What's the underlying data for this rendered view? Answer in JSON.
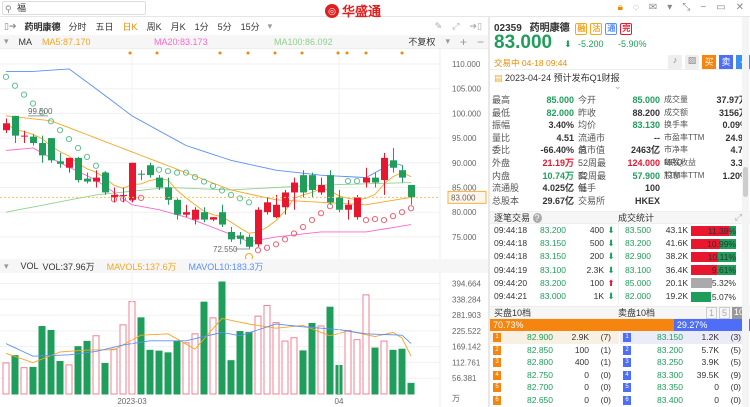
{
  "topbar": {
    "search_value": "福",
    "logo": "华盛通"
  },
  "toolbar": {
    "stock_name": "药明康德",
    "periods": [
      "分时",
      "五日",
      "日K",
      "周K",
      "月K",
      "1分",
      "5分",
      "15分"
    ],
    "active": "日K"
  },
  "ma_legend": {
    "label": "MA",
    "ma5": "MA5:87.170",
    "ma20": "MA20:83.173",
    "ma100": "MA100:86.092",
    "adjust": "不复权"
  },
  "vol_legend": {
    "label": "VOL",
    "vol": "VOL:37.96万",
    "mavol5": "MAVOL5:137.6万",
    "mavol10": "MAVOL10:183.3万"
  },
  "colors": {
    "up": "#e8162e",
    "down": "#1e9e5a",
    "ma5": "#f5a623",
    "ma20": "#ff66cc",
    "ma100": "#8fd18f",
    "blue": "#5b8ff9",
    "accent": "#f08a00"
  },
  "chart_data": [
    {
      "type": "candlestick",
      "title": "药明康德 日K",
      "yaxis": {
        "ticks": [
          110,
          105,
          100,
          95,
          90,
          85,
          80,
          75
        ],
        "tick_labels": [
          "110.000",
          "105.000",
          "100.000",
          "95.000",
          "90.000",
          "85.000",
          "80.000",
          "75.000"
        ],
        "range": [
          71,
          112
        ]
      },
      "current_price": "83.000",
      "high_label": "99.500",
      "low_label": "72.550",
      "xticks": [
        {
          "index": 14,
          "label": "2023-03"
        },
        {
          "index": 37,
          "label": "04"
        }
      ],
      "ohlc": [
        [
          96.6,
          99,
          96,
          98
        ],
        [
          99.5,
          99.5,
          94,
          95.5
        ],
        [
          95.3,
          96.5,
          94,
          95.5
        ],
        [
          95.3,
          95.8,
          93.5,
          94
        ],
        [
          94,
          95.5,
          90,
          91.5
        ],
        [
          95,
          95,
          90,
          90.5
        ],
        [
          90.3,
          92,
          89,
          89.8
        ],
        [
          89,
          91,
          88,
          91
        ],
        [
          91,
          91.2,
          86,
          86.5
        ],
        [
          86.8,
          88,
          85.8,
          86.2
        ],
        [
          86.2,
          88.5,
          85,
          87
        ],
        [
          88,
          88.3,
          83.5,
          84
        ],
        [
          83,
          85,
          82,
          83.5
        ],
        [
          83.3,
          85,
          82,
          83.5
        ],
        [
          82.5,
          90,
          82,
          90
        ],
        [
          87.8,
          88.5,
          86.5,
          87.6
        ],
        [
          89.5,
          90,
          87,
          87.5
        ],
        [
          87,
          87.5,
          84.5,
          85
        ],
        [
          85,
          87,
          81.5,
          82.5
        ],
        [
          82.5,
          82.8,
          78.5,
          79.5
        ],
        [
          79.5,
          81.5,
          79,
          80
        ],
        [
          78.5,
          81,
          77.5,
          80.5
        ],
        [
          80,
          81,
          78,
          78.5
        ],
        [
          78.5,
          79,
          78.2,
          79
        ],
        [
          80,
          81.5,
          77,
          77.5
        ],
        [
          76,
          77,
          74,
          74.5
        ],
        [
          75.3,
          76,
          73.5,
          74.6
        ],
        [
          75,
          75.5,
          72.55,
          73
        ],
        [
          73.5,
          81,
          73,
          80.5
        ],
        [
          80,
          83,
          79.5,
          82
        ],
        [
          79,
          83.5,
          78.8,
          81.5
        ],
        [
          81,
          84.5,
          79.5,
          84
        ],
        [
          84,
          87,
          80.5,
          86
        ],
        [
          87.5,
          88.5,
          83,
          84
        ],
        [
          87.5,
          88,
          83,
          84.5
        ],
        [
          84,
          87,
          83.5,
          85.5
        ],
        [
          87.5,
          88.5,
          81.5,
          82
        ],
        [
          83,
          84.5,
          80,
          80.5
        ],
        [
          80.5,
          82.5,
          78.5,
          81.5
        ],
        [
          79,
          83.5,
          78.5,
          83
        ],
        [
          86,
          89,
          85,
          87
        ],
        [
          87,
          88,
          85,
          86
        ],
        [
          86.5,
          92,
          83.5,
          91
        ],
        [
          90.5,
          93,
          88,
          89
        ],
        [
          88.5,
          89.5,
          86,
          87
        ],
        [
          85.5,
          85.5,
          81.5,
          83
        ]
      ],
      "lines": {
        "blue": [
          [
            0,
            108.5
          ],
          [
            3,
            108.5
          ],
          [
            7,
            109
          ],
          [
            10,
            105
          ],
          [
            14,
            99.5
          ],
          [
            17,
            96.5
          ],
          [
            20,
            93.5
          ],
          [
            25,
            90.5
          ],
          [
            30,
            88.5
          ],
          [
            35,
            87.5
          ],
          [
            40,
            87
          ],
          [
            43,
            90
          ],
          [
            44,
            89.5
          ]
        ],
        "ma20": [
          [
            0,
            92.5
          ],
          [
            3,
            93
          ],
          [
            6,
            90
          ],
          [
            10,
            86.5
          ],
          [
            14,
            81.5
          ],
          [
            17,
            80.5
          ],
          [
            20,
            79
          ],
          [
            25,
            75.5
          ],
          [
            27,
            74
          ],
          [
            30,
            75
          ],
          [
            35,
            76
          ],
          [
            40,
            76
          ],
          [
            45,
            77.5
          ]
        ],
        "ma100": [
          [
            0,
            80
          ],
          [
            10,
            83.5
          ],
          [
            18,
            85
          ],
          [
            25,
            84.5
          ],
          [
            35,
            85.5
          ],
          [
            45,
            86
          ]
        ],
        "orange_long": [
          [
            0,
            99.5
          ],
          [
            5,
            98.5
          ],
          [
            10,
            95
          ],
          [
            15,
            91.5
          ],
          [
            20,
            88
          ],
          [
            25,
            84.5
          ],
          [
            30,
            82.5
          ],
          [
            35,
            82
          ],
          [
            40,
            81.5
          ],
          [
            45,
            83
          ]
        ]
      },
      "sar": [
        107.4,
        105.6,
        103.8,
        102,
        100.2,
        98.4,
        96.6,
        94.8,
        93,
        91.2,
        89.4,
        87.6,
        82.6,
        82.7,
        82.8,
        82.9,
        88.9,
        88.6,
        88.3,
        88,
        88,
        87.1,
        86.2,
        85.3,
        84.4,
        83.5,
        82.8,
        82,
        72.3,
        72.8,
        73.5,
        74.5,
        75.7,
        77,
        78.4,
        79.8,
        81.2,
        82.5,
        86.3,
        86.3,
        78.4,
        78.6,
        78.4,
        79.2,
        80,
        80.8
      ]
    },
    {
      "type": "bar",
      "title": "VOL",
      "unit": "万",
      "yaxis": {
        "tick_labels": [
          "394.664",
          "338.284",
          "281.903",
          "225.522",
          "169.142",
          "112.761",
          "56.381"
        ],
        "range": [
          0,
          410
        ]
      },
      "values": [
        111,
        137,
        94,
        95,
        241,
        227,
        116,
        104,
        169,
        188,
        208,
        109,
        160,
        247,
        330,
        272,
        156,
        153,
        147,
        189,
        183,
        215,
        328,
        272,
        400,
        119,
        223,
        220,
        278,
        316,
        255,
        189,
        201,
        154,
        252,
        243,
        310,
        102,
        227,
        194,
        354,
        164,
        189,
        156,
        160,
        38
      ],
      "mavol5": [
        [
          0,
          145
        ],
        [
          3,
          112
        ],
        [
          6,
          150
        ],
        [
          9,
          157
        ],
        [
          12,
          158
        ],
        [
          15,
          210
        ],
        [
          18,
          215
        ],
        [
          21,
          160
        ],
        [
          24,
          270
        ],
        [
          27,
          250
        ],
        [
          30,
          235
        ],
        [
          33,
          245
        ],
        [
          36,
          208
        ],
        [
          38,
          225
        ],
        [
          41,
          205
        ],
        [
          43,
          220
        ],
        [
          44,
          200
        ],
        [
          45,
          135
        ]
      ],
      "mavol10": [
        [
          0,
          180
        ],
        [
          3,
          135
        ],
        [
          7,
          140
        ],
        [
          10,
          152
        ],
        [
          13,
          175
        ],
        [
          16,
          190
        ],
        [
          20,
          190
        ],
        [
          24,
          220
        ],
        [
          26,
          208
        ],
        [
          30,
          250
        ],
        [
          33,
          240
        ],
        [
          37,
          230
        ],
        [
          40,
          215
        ],
        [
          44,
          210
        ],
        [
          45,
          180
        ]
      ]
    }
  ],
  "quote": {
    "code": "02359",
    "name": "药明康德",
    "badges": [
      "融",
      "沽",
      "通",
      "完"
    ],
    "price": "83.000",
    "change": "-5.200",
    "change_pct": "-5.90%",
    "status": "交易中 04-18 09:44",
    "announcement": "2023-04-24 预计发布Q1财报",
    "action_btns": [
      "买",
      "卖",
      "+"
    ]
  },
  "stats": [
    [
      "最高",
      "85.000",
      "今开",
      "85.000",
      "成交量",
      "37.97万"
    ],
    [
      "最低",
      "82.000",
      "昨收",
      "88.200",
      "成交额",
      "3156万"
    ],
    [
      "振幅",
      "3.40%",
      "均价",
      "83.130",
      "换手率",
      "0.09%"
    ],
    [
      "量比",
      "4.51",
      "流通市值",
      "--",
      "市盈率TTM",
      "24.93"
    ],
    [
      "委比",
      "-66.40%",
      "总市值",
      "2463亿",
      "市净率MRQ",
      "4.72"
    ],
    [
      "外盘",
      "21.19万",
      "52周最高",
      "124.000",
      "每股收益TTM",
      "3.37"
    ],
    [
      "内盘",
      "10.74万",
      "52周最低",
      "57.900",
      "股息率TTM",
      "1.20%"
    ],
    [
      "流通股",
      "4.025亿",
      "每手",
      "100",
      "",
      ""
    ],
    [
      "总股本",
      "29.67亿",
      "交易所",
      "HKEX",
      "",
      ""
    ]
  ],
  "trades": {
    "title": "逐笔交易",
    "stats_title": "成交统计",
    "rows": [
      [
        "09:44:18",
        "83.200",
        "400",
        "down",
        "83.500",
        "43.1K",
        "11.38%",
        0.85
      ],
      [
        "09:44:18",
        "83.150",
        "500",
        "down",
        "83.200",
        "41.6K",
        "10.99%",
        0.64
      ],
      [
        "09:44:18",
        "83.150",
        "200",
        "down",
        "82.900",
        "38.2K",
        "10.11%",
        0.6
      ],
      [
        "09:44:19",
        "83.100",
        "2.3K",
        "down",
        "83.100",
        "36.4K",
        "9.61%",
        0.58
      ],
      [
        "09:44:20",
        "83.200",
        "100",
        "up",
        "85.000",
        "20.1K",
        "5.32%",
        0.05
      ],
      [
        "09:44:21",
        "83.000",
        "1K",
        "down",
        "82.000",
        "19.2K",
        "5.07%",
        0
      ]
    ]
  },
  "orderbook": {
    "bid_title": "买盘10档",
    "ask_title": "卖盘10档",
    "levels": [
      "1",
      "5",
      "10"
    ],
    "bid_pct": "70.73%",
    "ask_pct": "29.27%",
    "bid_ratio": 0.7073,
    "bids": [
      [
        "1",
        "82.900",
        "2.9K",
        "(7)"
      ],
      [
        "2",
        "82.850",
        "100",
        "(1)"
      ],
      [
        "3",
        "82.800",
        "400",
        "(1)"
      ],
      [
        "4",
        "82.750",
        "0",
        "(0)"
      ],
      [
        "5",
        "82.700",
        "0",
        "(0)"
      ],
      [
        "6",
        "82.650",
        "0",
        "(0)"
      ]
    ],
    "asks": [
      [
        "1",
        "83.150",
        "1.2K",
        "(3)"
      ],
      [
        "2",
        "83.200",
        "5.7K",
        "(5)"
      ],
      [
        "3",
        "83.250",
        "3.9K",
        "(5)"
      ],
      [
        "4",
        "83.300",
        "39.5K",
        "(9)"
      ],
      [
        "5",
        "83.350",
        "0",
        "(0)"
      ],
      [
        "6",
        "83.400",
        "0",
        "(0)"
      ]
    ]
  }
}
